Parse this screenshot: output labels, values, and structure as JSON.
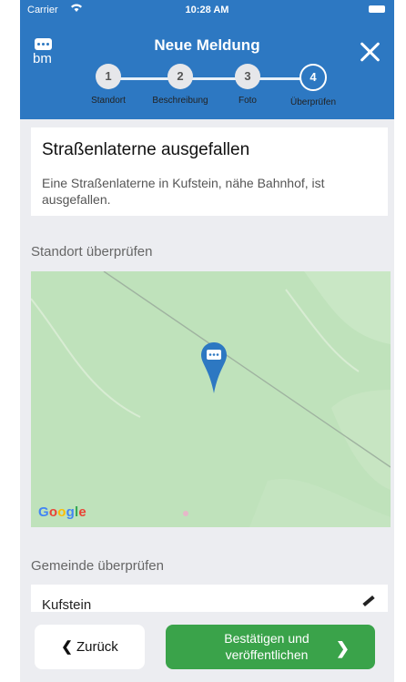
{
  "status_bar": {
    "carrier": "Carrier",
    "time": "10:28 AM"
  },
  "header": {
    "logo_text": "bm",
    "title": "Neue Meldung"
  },
  "steps": [
    {
      "number": "1",
      "label": "Standort"
    },
    {
      "number": "2",
      "label": "Beschreibung"
    },
    {
      "number": "3",
      "label": "Foto"
    },
    {
      "number": "4",
      "label": "Überprüfen"
    }
  ],
  "report": {
    "title": "Straßenlaterne ausgefallen",
    "description": "Eine Straßenlaterne in Kufstein, nähe Bahnhof, ist ausgefallen."
  },
  "location_section": {
    "label": "Standort überprüfen",
    "map_attribution": "Google"
  },
  "municipality_section": {
    "label": "Gemeinde überprüfen",
    "value": "Kufstein"
  },
  "footer": {
    "back_label": "Zurück",
    "confirm_label": "Bestätigen und veröffentlichen"
  },
  "colors": {
    "header_bg": "#2d78c2",
    "confirm_bg": "#3aa34a",
    "map_bg": "#b9deb5"
  }
}
